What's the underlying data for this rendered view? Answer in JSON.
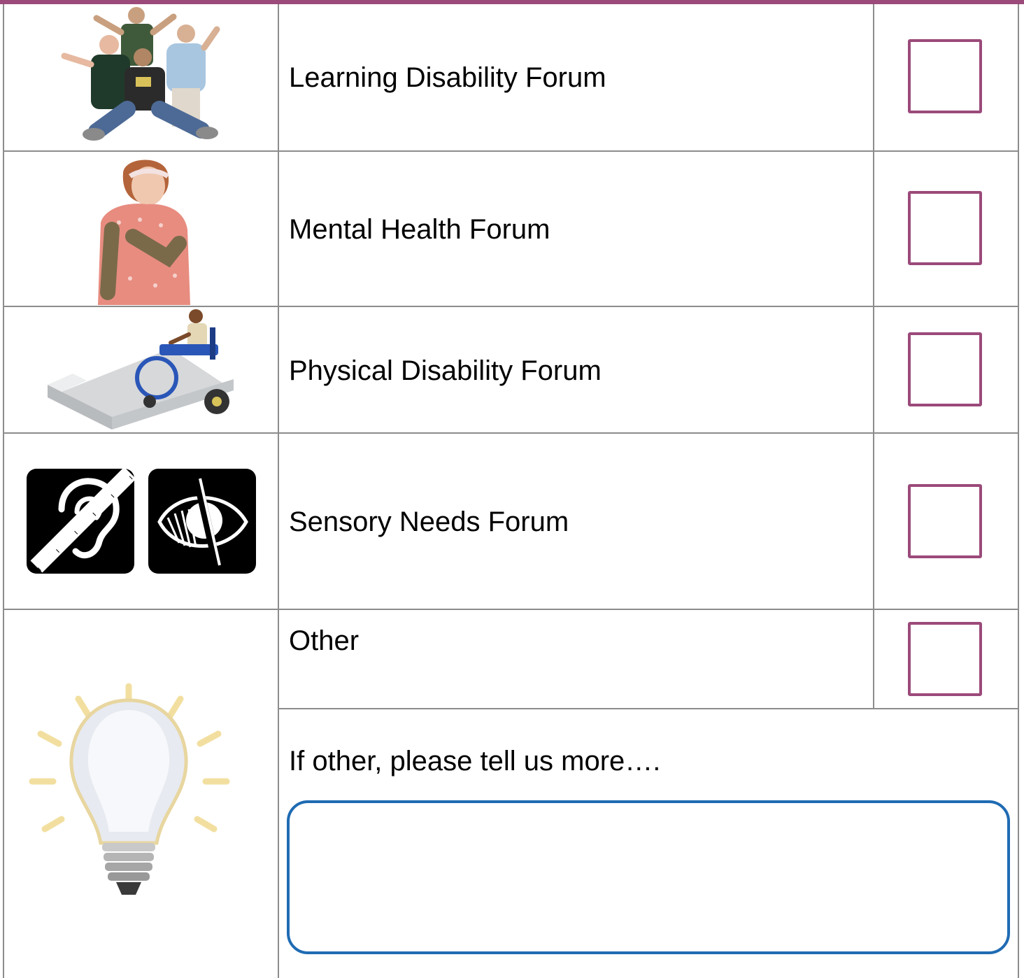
{
  "colors": {
    "accent": "#9b4a7a",
    "input_border": "#1f6bb3",
    "grid": "#8c8c8c"
  },
  "rows": [
    {
      "label": "Learning Disability Forum",
      "icon": "group-of-people-icon",
      "checked": false
    },
    {
      "label": "Mental Health Forum",
      "icon": "sad-woman-icon",
      "checked": false
    },
    {
      "label": "Physical Disability Forum",
      "icon": "wheelchair-ramp-icon",
      "checked": false
    },
    {
      "label": "Sensory Needs Forum",
      "icon": "hearing-and-sight-impairment-icon",
      "checked": false
    },
    {
      "label": "Other",
      "icon": "lightbulb-icon",
      "checked": false
    }
  ],
  "other_details": {
    "prompt": "If other, please tell us more….",
    "value": ""
  }
}
